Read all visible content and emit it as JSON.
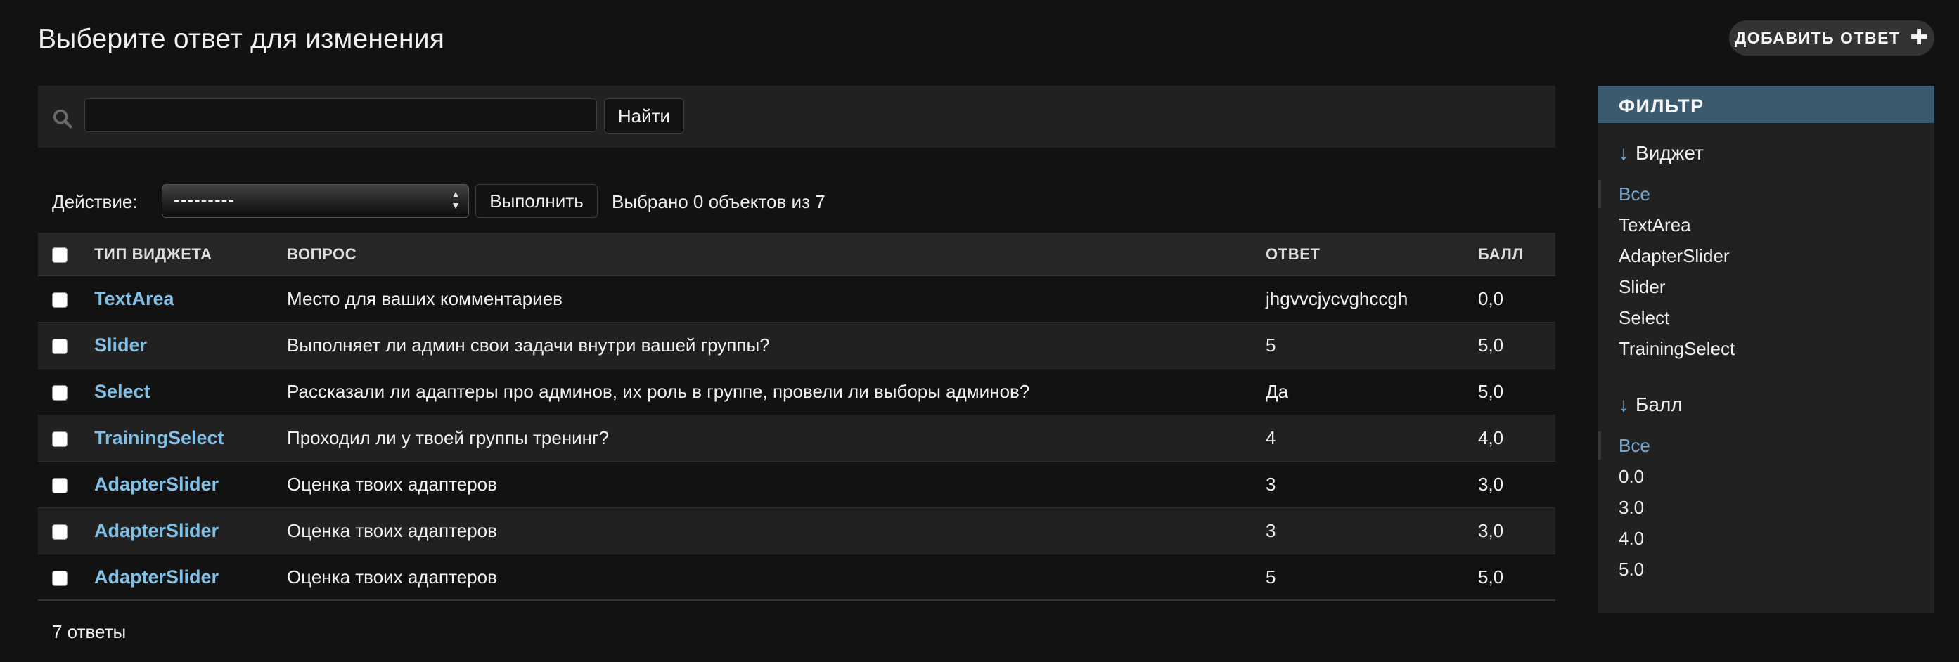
{
  "header": {
    "title": "Выберите ответ для изменения",
    "add_button_label": "ДОБАВИТЬ ОТВЕТ"
  },
  "search": {
    "value": "",
    "placeholder": "",
    "button_label": "Найти"
  },
  "actions": {
    "label": "Действие:",
    "select_value": "---------",
    "run_label": "Выполнить",
    "selection_status": "Выбрано 0 объектов из 7"
  },
  "table": {
    "columns": [
      "ТИП ВИДЖЕТА",
      "ВОПРОС",
      "ОТВЕТ",
      "БАЛЛ"
    ],
    "rows": [
      {
        "type": "TextArea",
        "question": "Место для ваших комментариев",
        "answer": "jhgvvcjycvghccgh",
        "score": "0,0"
      },
      {
        "type": "Slider",
        "question": "Выполняет ли админ свои задачи внутри вашей группы?",
        "answer": "5",
        "score": "5,0"
      },
      {
        "type": "Select",
        "question": "Рассказали ли адаптеры про админов, их роль в группе, провели ли выборы админов?",
        "answer": "Да",
        "score": "5,0"
      },
      {
        "type": "TrainingSelect",
        "question": "Проходил ли у твоей группы тренинг?",
        "answer": "4",
        "score": "4,0"
      },
      {
        "type": "AdapterSlider",
        "question": "Оценка твоих адаптеров",
        "answer": "3",
        "score": "3,0"
      },
      {
        "type": "AdapterSlider",
        "question": "Оценка твоих адаптеров",
        "answer": "3",
        "score": "3,0"
      },
      {
        "type": "AdapterSlider",
        "question": "Оценка твоих адаптеров",
        "answer": "5",
        "score": "5,0"
      }
    ],
    "footer": "7 ответы"
  },
  "filter": {
    "title": "ФИЛЬТР",
    "groups": [
      {
        "heading": "Виджет",
        "items": [
          "Все",
          "TextArea",
          "AdapterSlider",
          "Slider",
          "Select",
          "TrainingSelect"
        ],
        "selected": "Все"
      },
      {
        "heading": "Балл",
        "items": [
          "Все",
          "0.0",
          "3.0",
          "4.0",
          "5.0"
        ],
        "selected": "Все"
      }
    ]
  },
  "colors": {
    "background": "#121212",
    "link": "#81c0e6",
    "filter_header": "#3c5a6e",
    "filter_selected": "#7aa7cf"
  },
  "icons": {
    "search": "search-icon",
    "add": "plus-icon",
    "filter_heading": "arrow-down-icon"
  }
}
